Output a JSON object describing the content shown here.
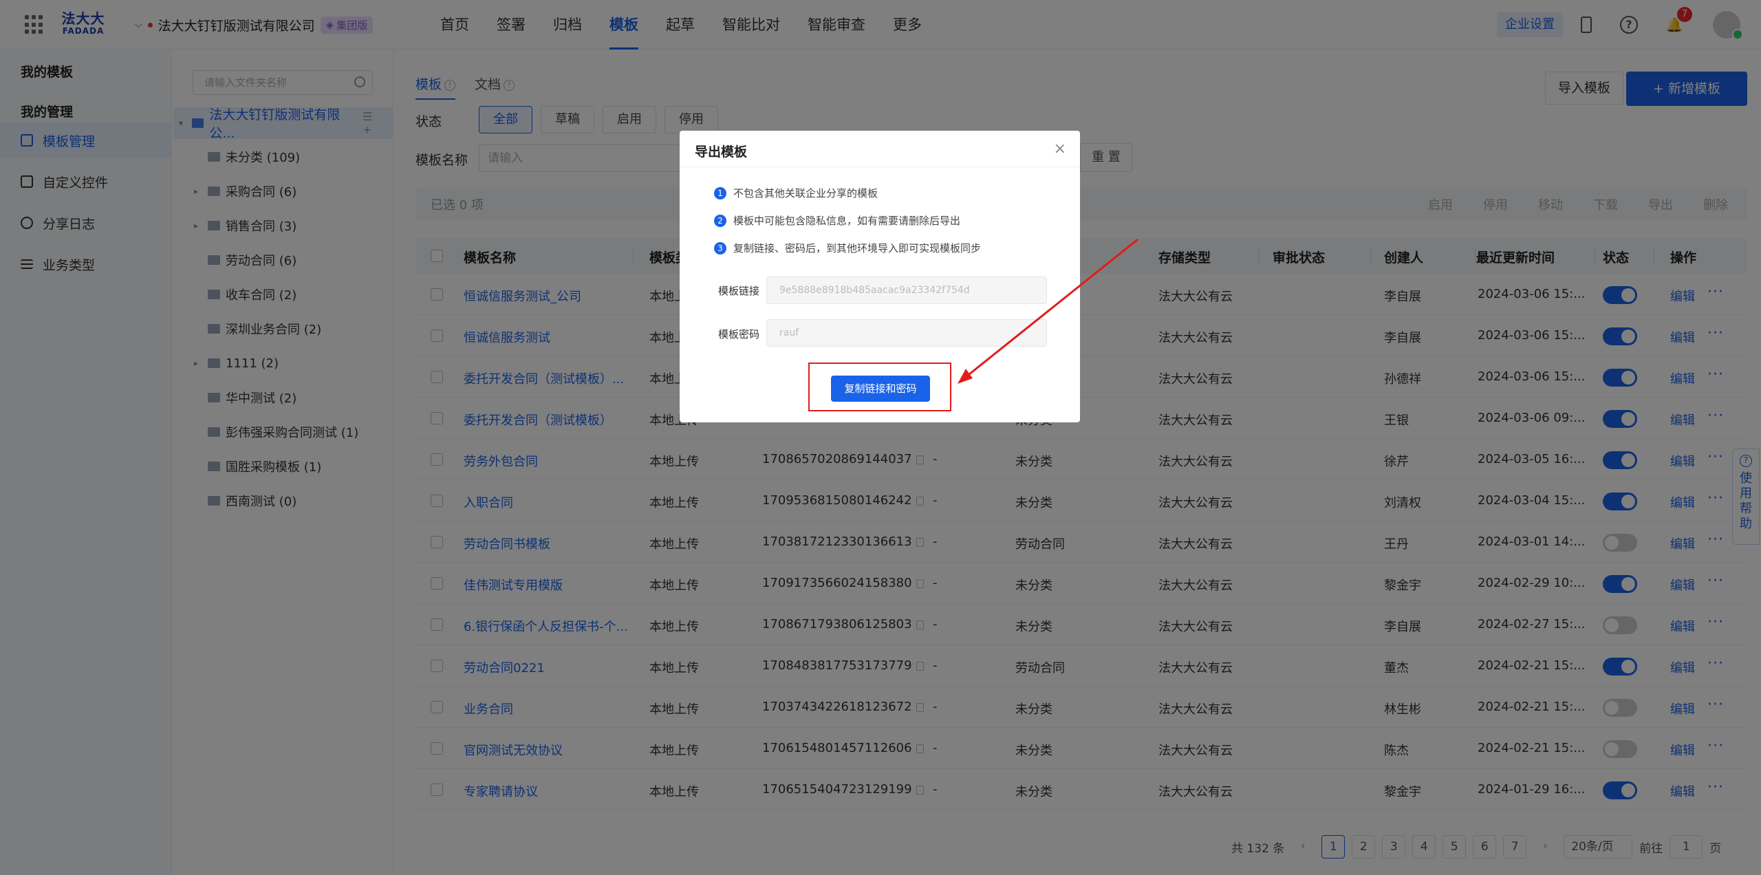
{
  "topbar": {
    "logo_cn": "法大大",
    "logo_en": "FADADA",
    "company": "法大大钉钉版测试有限公司",
    "edition": "集团版",
    "nav": [
      "首页",
      "签署",
      "归档",
      "模板",
      "起草",
      "智能比对",
      "智能审查",
      "更多"
    ],
    "enterprise_settings": "企业设置",
    "notify_count": "7"
  },
  "sidebar": {
    "my_templates": "我的模板",
    "my_management": "我的管理",
    "items": [
      "模板管理",
      "自定义控件",
      "分享日志",
      "业务类型"
    ]
  },
  "tree": {
    "search_placeholder": "请输入文件夹名称",
    "root": "法大大钉钉版测试有限公...",
    "nodes": [
      "未分类 (109)",
      "采购合同 (6)",
      "销售合同 (3)",
      "劳动合同 (6)",
      "收车合同 (2)",
      "深圳业务合同 (2)",
      "1111 (2)",
      "华中测试 (2)",
      "彭伟强采购合同测试 (1)",
      "国胜采购模板 (1)",
      "西南测试 (0)"
    ]
  },
  "main": {
    "tabs": [
      "模板",
      "文档"
    ],
    "import_btn": "导入模板",
    "add_btn": "+ 新增模板",
    "status_label": "状态",
    "status_chips": [
      "全部",
      "草稿",
      "启用",
      "停用"
    ],
    "name_label": "模板名称",
    "name_placeholder": "请输入",
    "reset": "重 置",
    "selected": "已选 0 项",
    "bulk_actions": [
      "启用",
      "停用",
      "移动",
      "下载",
      "导出",
      "删除"
    ]
  },
  "table": {
    "headers": [
      "模板名称",
      "模板类",
      "存储类型",
      "审批状态",
      "创建人",
      "最近更新时间",
      "状态",
      "操作"
    ],
    "rows": [
      {
        "name": "恒诚信服务测试_公司",
        "src": "本地上传",
        "id": "",
        "dash": "",
        "cat": "",
        "storage": "法大大公有云",
        "creator": "李自展",
        "time": "2024-03-06 15:...",
        "on": true
      },
      {
        "name": "恒诚信服务测试",
        "src": "本地上传",
        "id": "",
        "dash": "",
        "cat": "",
        "storage": "法大大公有云",
        "creator": "李自展",
        "time": "2024-03-06 15:...",
        "on": true
      },
      {
        "name": "委托开发合同（测试模板）...",
        "src": "本地上传",
        "id": "",
        "dash": "",
        "cat": "",
        "storage": "法大大公有云",
        "creator": "孙德祥",
        "time": "2024-03-06 15:...",
        "on": true
      },
      {
        "name": "委托开发合同（测试模板）",
        "src": "本地上传",
        "id": "",
        "dash": "",
        "cat": "未分类",
        "storage": "法大大公有云",
        "creator": "王银",
        "time": "2024-03-06 09:...",
        "on": true
      },
      {
        "name": "劳务外包合同",
        "src": "本地上传",
        "id": "1708657020869144037",
        "dash": "-",
        "cat": "未分类",
        "storage": "法大大公有云",
        "creator": "徐芹",
        "time": "2024-03-05 16:...",
        "on": true
      },
      {
        "name": "入职合同",
        "src": "本地上传",
        "id": "1709536815080146242",
        "dash": "-",
        "cat": "未分类",
        "storage": "法大大公有云",
        "creator": "刘清权",
        "time": "2024-03-04 15:...",
        "on": true
      },
      {
        "name": "劳动合同书模板",
        "src": "本地上传",
        "id": "1703817212330136613",
        "dash": "-",
        "cat": "劳动合同",
        "storage": "法大大公有云",
        "creator": "王丹",
        "time": "2024-03-01 14:...",
        "on": false
      },
      {
        "name": "佳伟测试专用模版",
        "src": "本地上传",
        "id": "1709173566024158380",
        "dash": "-",
        "cat": "未分类",
        "storage": "法大大公有云",
        "creator": "黎金宇",
        "time": "2024-02-29 10:...",
        "on": true
      },
      {
        "name": "6.银行保函个人反担保书-个...",
        "src": "本地上传",
        "id": "1708671793806125803",
        "dash": "-",
        "cat": "未分类",
        "storage": "法大大公有云",
        "creator": "李自展",
        "time": "2024-02-27 15:...",
        "on": false
      },
      {
        "name": "劳动合同0221",
        "src": "本地上传",
        "id": "1708483817753173779",
        "dash": "-",
        "cat": "劳动合同",
        "storage": "法大大公有云",
        "creator": "董杰",
        "time": "2024-02-21 15:...",
        "on": true
      },
      {
        "name": "业务合同",
        "src": "本地上传",
        "id": "1703743422618123672",
        "dash": "-",
        "cat": "未分类",
        "storage": "法大大公有云",
        "creator": "林生彬",
        "time": "2024-02-21 15:...",
        "on": false
      },
      {
        "name": "官网测试无效协议",
        "src": "本地上传",
        "id": "1706154801457112606",
        "dash": "-",
        "cat": "未分类",
        "storage": "法大大公有云",
        "creator": "陈杰",
        "time": "2024-02-21 15:...",
        "on": false
      },
      {
        "name": "专家聘请协议",
        "src": "本地上传",
        "id": "1706515404723129199",
        "dash": "-",
        "cat": "未分类",
        "storage": "法大大公有云",
        "creator": "黎金宇",
        "time": "2024-01-29 16:...",
        "on": true
      }
    ],
    "edit": "编辑"
  },
  "help_float": "使用帮助",
  "pager": {
    "total": "共 132 条",
    "pages": [
      "1",
      "2",
      "3",
      "4",
      "5",
      "6",
      "7"
    ],
    "size": "20条/页",
    "goto": "前往",
    "goto_value": "1",
    "page_unit": "页"
  },
  "modal": {
    "title": "导出模板",
    "tips": [
      "不包含其他关联企业分享的模板",
      "模板中可能包含隐私信息，如有需要请删除后导出",
      "复制链接、密码后，到其他环境导入即可实现模板同步"
    ],
    "link_label": "模板链接",
    "link_value": "9e5888e8918b485aacac9a23342f754d",
    "pwd_label": "模板密码",
    "pwd_value": "rauf",
    "copy_btn": "复制链接和密码"
  },
  "colors": {
    "accent": "#1a63e8",
    "annotation": "#e21b1b"
  }
}
